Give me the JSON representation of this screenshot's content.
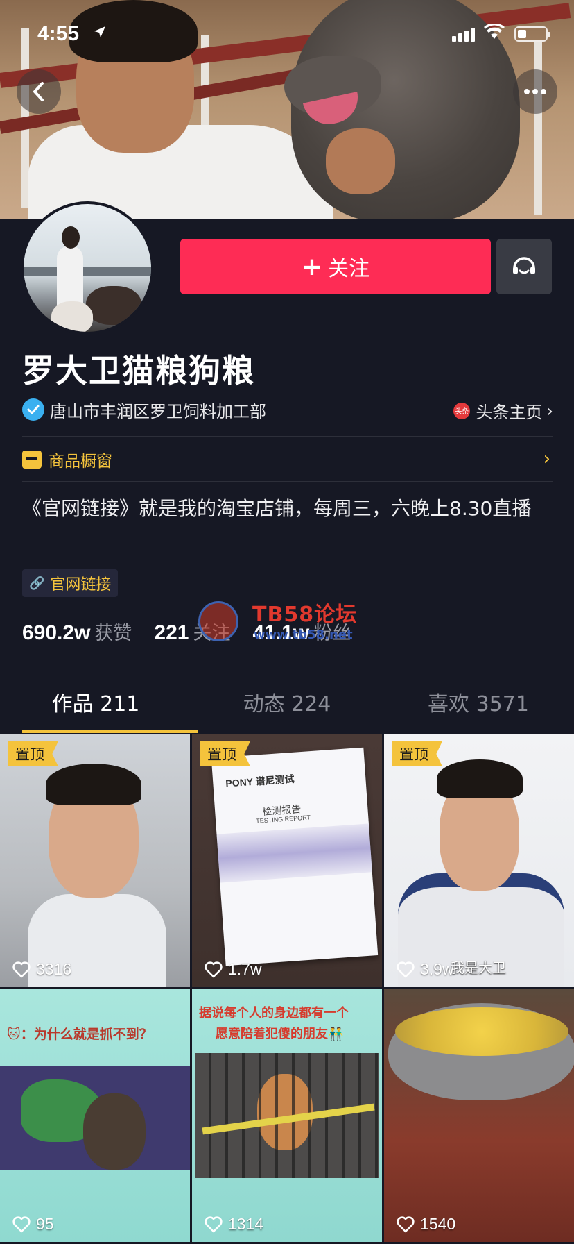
{
  "status_bar": {
    "time": "4:55",
    "location_icon": "location-arrow-icon"
  },
  "header": {
    "back_icon": "chevron-left-icon",
    "more_icon": "ellipsis-icon"
  },
  "profile": {
    "follow_label": "关注",
    "message_icon": "message-icon",
    "name": "罗大卫猫粮狗粮",
    "verified_text": "唐山市丰润区罗卫饲料加工部",
    "toutiao_icon_text": "头条",
    "toutiao_label": "头条主页",
    "shop_label": "商品橱窗",
    "bio": "《官网链接》就是我的淘宝店铺，每周三，六晚上8.30直播",
    "link_label": "官网链接",
    "stats": [
      {
        "value": "690.2w",
        "label": "获赞"
      },
      {
        "value": "221",
        "label": "关注"
      },
      {
        "value": "41.1w",
        "label": "粉丝"
      }
    ]
  },
  "watermark": {
    "title": "TB58论坛",
    "url": "www.tb58.net"
  },
  "tabs": [
    {
      "label": "作品 211",
      "active": true
    },
    {
      "label": "动态 224",
      "active": false
    },
    {
      "label": "喜欢 3571",
      "active": false
    }
  ],
  "videos": [
    {
      "pinned": "置顶",
      "likes": "3316"
    },
    {
      "pinned": "置顶",
      "likes": "1.7w",
      "doc_brand": "PONY 谱尼测试",
      "doc_title": "检测报告",
      "doc_sub": "TESTING REPORT"
    },
    {
      "pinned": "置顶",
      "likes": "3.9w",
      "subtitle": "我是大卫"
    },
    {
      "likes": "95",
      "caption": "🐱：为什么就是抓不到？"
    },
    {
      "likes": "1314",
      "caption1": "据说每个人的身边都有一个",
      "caption2": "愿意陪着犯傻的朋友👬"
    },
    {
      "likes": "1540"
    }
  ],
  "colors": {
    "accent": "#fe2c55",
    "highlight": "#f4c33c",
    "background": "#161824",
    "verified": "#3ab0f0"
  }
}
